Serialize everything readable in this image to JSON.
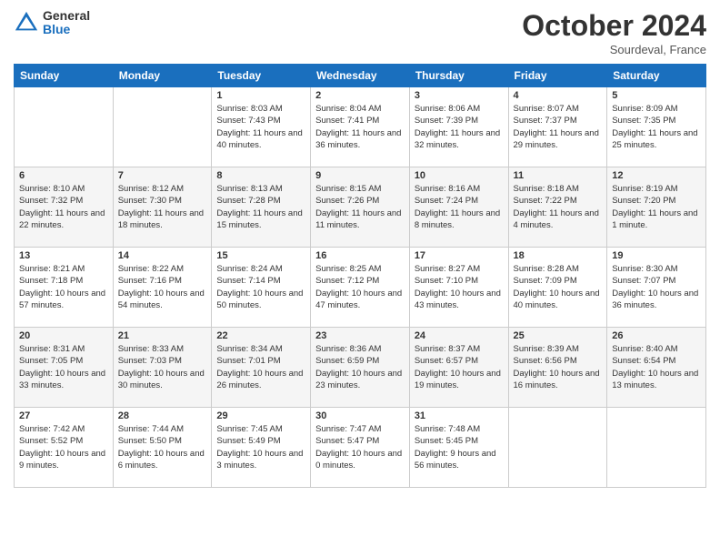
{
  "header": {
    "logo_general": "General",
    "logo_blue": "Blue",
    "month": "October 2024",
    "location": "Sourdeval, France"
  },
  "weekdays": [
    "Sunday",
    "Monday",
    "Tuesday",
    "Wednesday",
    "Thursday",
    "Friday",
    "Saturday"
  ],
  "weeks": [
    [
      {
        "day": "",
        "info": ""
      },
      {
        "day": "",
        "info": ""
      },
      {
        "day": "1",
        "info": "Sunrise: 8:03 AM\nSunset: 7:43 PM\nDaylight: 11 hours and 40 minutes."
      },
      {
        "day": "2",
        "info": "Sunrise: 8:04 AM\nSunset: 7:41 PM\nDaylight: 11 hours and 36 minutes."
      },
      {
        "day": "3",
        "info": "Sunrise: 8:06 AM\nSunset: 7:39 PM\nDaylight: 11 hours and 32 minutes."
      },
      {
        "day": "4",
        "info": "Sunrise: 8:07 AM\nSunset: 7:37 PM\nDaylight: 11 hours and 29 minutes."
      },
      {
        "day": "5",
        "info": "Sunrise: 8:09 AM\nSunset: 7:35 PM\nDaylight: 11 hours and 25 minutes."
      }
    ],
    [
      {
        "day": "6",
        "info": "Sunrise: 8:10 AM\nSunset: 7:32 PM\nDaylight: 11 hours and 22 minutes."
      },
      {
        "day": "7",
        "info": "Sunrise: 8:12 AM\nSunset: 7:30 PM\nDaylight: 11 hours and 18 minutes."
      },
      {
        "day": "8",
        "info": "Sunrise: 8:13 AM\nSunset: 7:28 PM\nDaylight: 11 hours and 15 minutes."
      },
      {
        "day": "9",
        "info": "Sunrise: 8:15 AM\nSunset: 7:26 PM\nDaylight: 11 hours and 11 minutes."
      },
      {
        "day": "10",
        "info": "Sunrise: 8:16 AM\nSunset: 7:24 PM\nDaylight: 11 hours and 8 minutes."
      },
      {
        "day": "11",
        "info": "Sunrise: 8:18 AM\nSunset: 7:22 PM\nDaylight: 11 hours and 4 minutes."
      },
      {
        "day": "12",
        "info": "Sunrise: 8:19 AM\nSunset: 7:20 PM\nDaylight: 11 hours and 1 minute."
      }
    ],
    [
      {
        "day": "13",
        "info": "Sunrise: 8:21 AM\nSunset: 7:18 PM\nDaylight: 10 hours and 57 minutes."
      },
      {
        "day": "14",
        "info": "Sunrise: 8:22 AM\nSunset: 7:16 PM\nDaylight: 10 hours and 54 minutes."
      },
      {
        "day": "15",
        "info": "Sunrise: 8:24 AM\nSunset: 7:14 PM\nDaylight: 10 hours and 50 minutes."
      },
      {
        "day": "16",
        "info": "Sunrise: 8:25 AM\nSunset: 7:12 PM\nDaylight: 10 hours and 47 minutes."
      },
      {
        "day": "17",
        "info": "Sunrise: 8:27 AM\nSunset: 7:10 PM\nDaylight: 10 hours and 43 minutes."
      },
      {
        "day": "18",
        "info": "Sunrise: 8:28 AM\nSunset: 7:09 PM\nDaylight: 10 hours and 40 minutes."
      },
      {
        "day": "19",
        "info": "Sunrise: 8:30 AM\nSunset: 7:07 PM\nDaylight: 10 hours and 36 minutes."
      }
    ],
    [
      {
        "day": "20",
        "info": "Sunrise: 8:31 AM\nSunset: 7:05 PM\nDaylight: 10 hours and 33 minutes."
      },
      {
        "day": "21",
        "info": "Sunrise: 8:33 AM\nSunset: 7:03 PM\nDaylight: 10 hours and 30 minutes."
      },
      {
        "day": "22",
        "info": "Sunrise: 8:34 AM\nSunset: 7:01 PM\nDaylight: 10 hours and 26 minutes."
      },
      {
        "day": "23",
        "info": "Sunrise: 8:36 AM\nSunset: 6:59 PM\nDaylight: 10 hours and 23 minutes."
      },
      {
        "day": "24",
        "info": "Sunrise: 8:37 AM\nSunset: 6:57 PM\nDaylight: 10 hours and 19 minutes."
      },
      {
        "day": "25",
        "info": "Sunrise: 8:39 AM\nSunset: 6:56 PM\nDaylight: 10 hours and 16 minutes."
      },
      {
        "day": "26",
        "info": "Sunrise: 8:40 AM\nSunset: 6:54 PM\nDaylight: 10 hours and 13 minutes."
      }
    ],
    [
      {
        "day": "27",
        "info": "Sunrise: 7:42 AM\nSunset: 5:52 PM\nDaylight: 10 hours and 9 minutes."
      },
      {
        "day": "28",
        "info": "Sunrise: 7:44 AM\nSunset: 5:50 PM\nDaylight: 10 hours and 6 minutes."
      },
      {
        "day": "29",
        "info": "Sunrise: 7:45 AM\nSunset: 5:49 PM\nDaylight: 10 hours and 3 minutes."
      },
      {
        "day": "30",
        "info": "Sunrise: 7:47 AM\nSunset: 5:47 PM\nDaylight: 10 hours and 0 minutes."
      },
      {
        "day": "31",
        "info": "Sunrise: 7:48 AM\nSunset: 5:45 PM\nDaylight: 9 hours and 56 minutes."
      },
      {
        "day": "",
        "info": ""
      },
      {
        "day": "",
        "info": ""
      }
    ]
  ]
}
